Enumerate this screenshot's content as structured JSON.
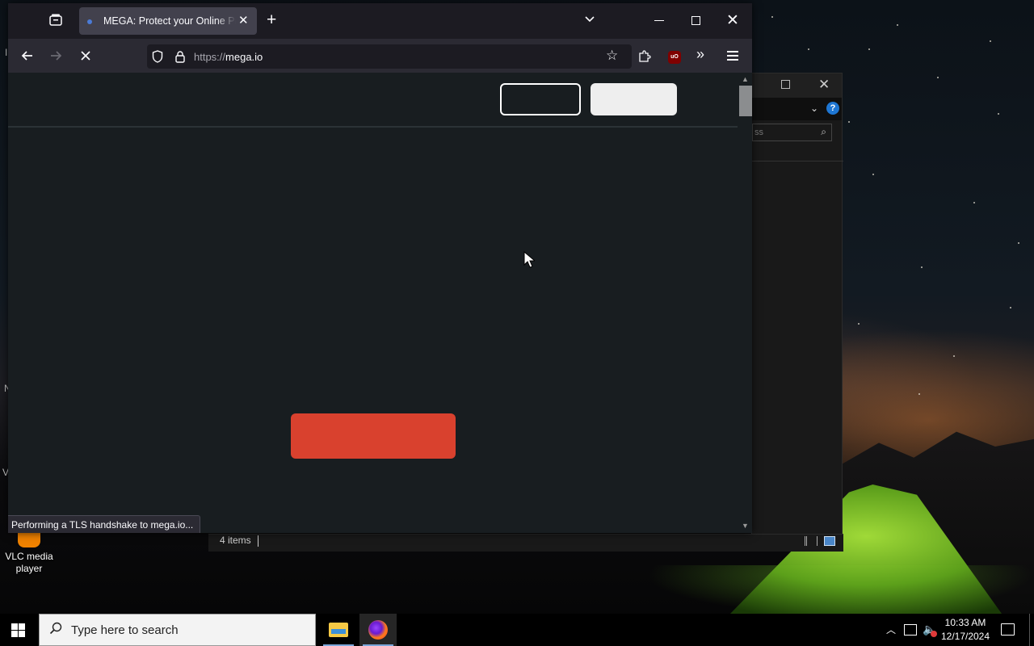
{
  "browser": {
    "tab": {
      "title": "MEGA: Protect your Online Privacy"
    },
    "url": {
      "scheme": "https://",
      "host": "mega.io"
    },
    "status_text": "Performing a TLS handshake to mega.io...",
    "extension_badge": "uO"
  },
  "explorer": {
    "search_placeholder": "ss",
    "status_items": "4 items"
  },
  "desktop": {
    "icons": [
      {
        "label": "VLC media player"
      }
    ],
    "edge_fragments": [
      "I",
      "N",
      "V"
    ]
  },
  "taskbar": {
    "search_placeholder": "Type here to search",
    "clock": {
      "time": "10:33 AM",
      "date": "12/17/2024"
    }
  },
  "colors": {
    "page_background": "#181d20",
    "accent_red": "#d9412e",
    "toolbar": "#2b2a33",
    "tab_active": "#42414d"
  }
}
